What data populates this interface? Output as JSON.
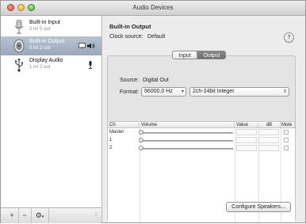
{
  "window": {
    "title": "Audio Devices"
  },
  "devices": [
    {
      "name": "Built-in Input",
      "io": "2 in/ 0 out",
      "icon": "microphone-icon",
      "selected": false
    },
    {
      "name": "Built-in Output",
      "io": "0 in/ 2 out",
      "icon": "speaker-icon",
      "selected": true
    },
    {
      "name": "Display Audio",
      "io": "1 in/ 2 out",
      "icon": "usb-icon",
      "selected": false
    }
  ],
  "sidebar_footer": {
    "add": "+",
    "remove": "−",
    "gear": "⚙"
  },
  "detail": {
    "device_title": "Built-in Output",
    "clock_label": "Clock source:",
    "clock_value": "Default",
    "help": "?"
  },
  "tabs": {
    "input": "Input",
    "output": "Output",
    "selected": "Output"
  },
  "output": {
    "source_label": "Source:",
    "source_value": "Digital Out",
    "format_label": "Format:",
    "sample_rate": "96000.0 Hz",
    "bit_format": "2ch-24bit Integer"
  },
  "table": {
    "headers": {
      "ch": "Ch",
      "volume": "Volume",
      "value": "Value",
      "db": "dB",
      "mute": "Mute"
    },
    "rows": [
      {
        "ch": "Master"
      },
      {
        "ch": "1"
      },
      {
        "ch": "2"
      }
    ]
  },
  "configure_button": "Configure Speakers..."
}
